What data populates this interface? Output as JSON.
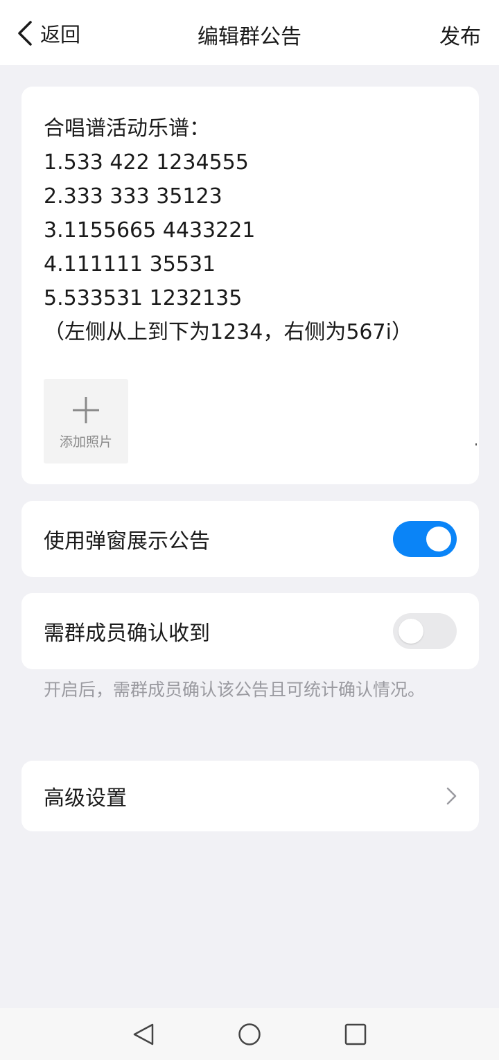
{
  "header": {
    "back_label": "返回",
    "title": "编辑群公告",
    "publish_label": "发布"
  },
  "notice": {
    "text": "合唱谱活动乐谱：\n1.533 422 1234555\n2.333 333 35123\n3.1155665 4433221\n4.111111 35531\n5.533531 1232135\n（左侧从上到下为1234，右侧为567i）",
    "add_photo_label": "添加照片"
  },
  "settings": {
    "popup": {
      "label": "使用弹窗展示公告",
      "enabled": true
    },
    "confirm": {
      "label": "需群成员确认收到",
      "enabled": false
    },
    "confirm_hint": "开启后，需群成员确认该公告且可统计确认情况。",
    "advanced": {
      "label": "高级设置"
    }
  },
  "colors": {
    "accent": "#0A84F7",
    "background": "#F1F1F5",
    "hint": "#9A9AA0"
  },
  "icons": {
    "back": "chevron-left-icon",
    "add": "plus-icon",
    "advanced": "chevron-right-icon",
    "nav_back": "triangle-back-icon",
    "nav_home": "circle-home-icon",
    "nav_recent": "square-recent-icon"
  }
}
